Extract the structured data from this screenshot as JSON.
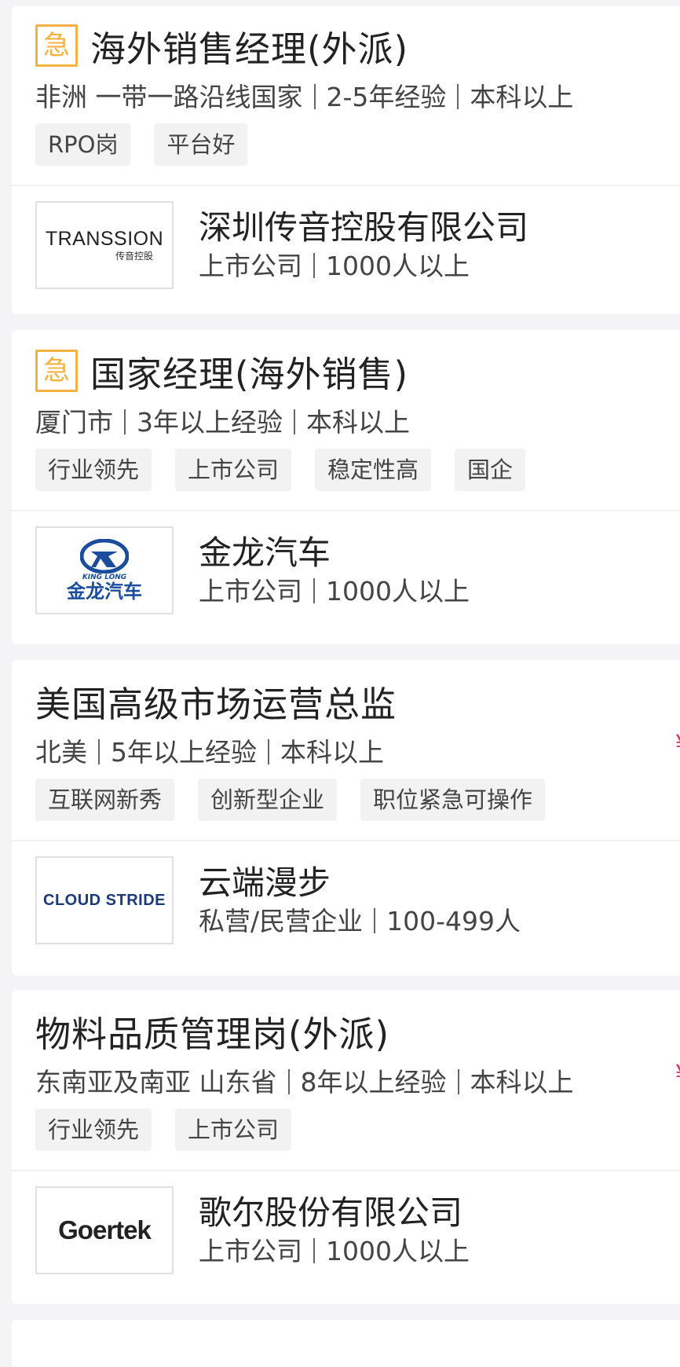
{
  "jobs": [
    {
      "urgent_label": "急",
      "title": "海外销售经理(外派)",
      "location": "非洲 一带一路沿线国家",
      "experience": "2-5年经验",
      "education": "本科以上",
      "tags": [
        "RPO岗",
        "平台好"
      ],
      "company": {
        "name": "深圳传音控股有限公司",
        "type": "上市公司",
        "size": "1000人以上",
        "logo_text": "TRANSSION",
        "logo_subtext": "传音控股"
      }
    },
    {
      "urgent_label": "急",
      "title": "国家经理(海外销售)",
      "location": "厦门市",
      "experience": "3年以上经验",
      "education": "本科以上",
      "tags": [
        "行业领先",
        "上市公司",
        "稳定性高",
        "国企"
      ],
      "company": {
        "name": "金龙汽车",
        "type": "上市公司",
        "size": "1000人以上",
        "logo_text": "金龙汽车",
        "logo_subtext": "KING LONG"
      }
    },
    {
      "title": "美国高级市场运营总监",
      "location": "北美",
      "experience": "5年以上经验",
      "education": "本科以上",
      "salary_symbol": "¥",
      "tags": [
        "互联网新秀",
        "创新型企业",
        "职位紧急可操作"
      ],
      "company": {
        "name": "云端漫步",
        "type": "私营/民营企业",
        "size": "100-499人",
        "logo_text": "CLOUD STRIDE"
      }
    },
    {
      "title": "物料品质管理岗(外派)",
      "location": "东南亚及南亚 山东省",
      "experience": "8年以上经验",
      "education": "本科以上",
      "salary_symbol": "¥",
      "tags": [
        "行业领先",
        "上市公司"
      ],
      "company": {
        "name": "歌尔股份有限公司",
        "type": "上市公司",
        "size": "1000人以上",
        "logo_text": "Goertek"
      }
    }
  ],
  "colors": {
    "urgent": "#f4b341",
    "salary": "#e8365c",
    "background": "#f4f4f6",
    "kinglong_blue": "#1a4d9c"
  }
}
